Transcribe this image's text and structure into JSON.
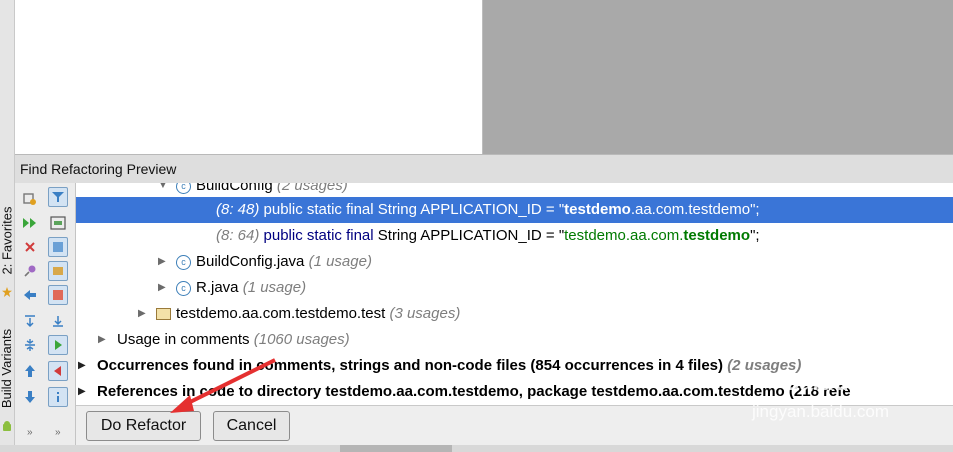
{
  "panel": {
    "title": "Find Refactoring Preview"
  },
  "side_tabs": {
    "favorites": "2: Favorites",
    "build_variants": "Build Variants"
  },
  "tree": {
    "row0": {
      "name": "BuildConfig",
      "usages": "(2 usages)"
    },
    "row1": {
      "loc": "(8: 48)",
      "kw": "public static final",
      "type": "String APPLICATION_ID = ",
      "q1": "\"",
      "strA": "testdemo",
      "strB": ".aa.com.testdemo",
      "q2": "\"",
      "semi": ";"
    },
    "row2": {
      "loc": "(8: 64)",
      "kw": "public static final",
      "type": "String APPLICATION_ID = ",
      "q1": "\"",
      "strA": "testdemo.aa.com.",
      "strB": "testdemo",
      "q2": "\"",
      "semi": ";"
    },
    "row3": {
      "name": "BuildConfig.java",
      "usages": "(1 usage)"
    },
    "row4": {
      "name": "R.java",
      "usages": "(1 usage)"
    },
    "row5": {
      "name": "testdemo.aa.com.testdemo.test",
      "usages": "(3 usages)"
    },
    "row6": {
      "name": "Usage in comments",
      "usages": "(1060 usages)"
    },
    "row7": {
      "text": "Occurrences found in comments, strings and non-code files  (854 occurrences in 4 files)",
      "usages": "(2 usages)"
    },
    "row8": {
      "text": "References in code to directory testdemo.aa.com.testdemo, package testdemo.aa.com.testdemo (218 refe"
    }
  },
  "buttons": {
    "do_refactor": "Do Refactor",
    "cancel": "Cancel"
  },
  "watermark": {
    "brand": "Baidu 经验",
    "url": "jingyan.baidu.com"
  },
  "colors": {
    "selection": "#3a75d7",
    "keyword": "#000080",
    "string": "#007a00",
    "annotation_arrow": "#e53030"
  }
}
